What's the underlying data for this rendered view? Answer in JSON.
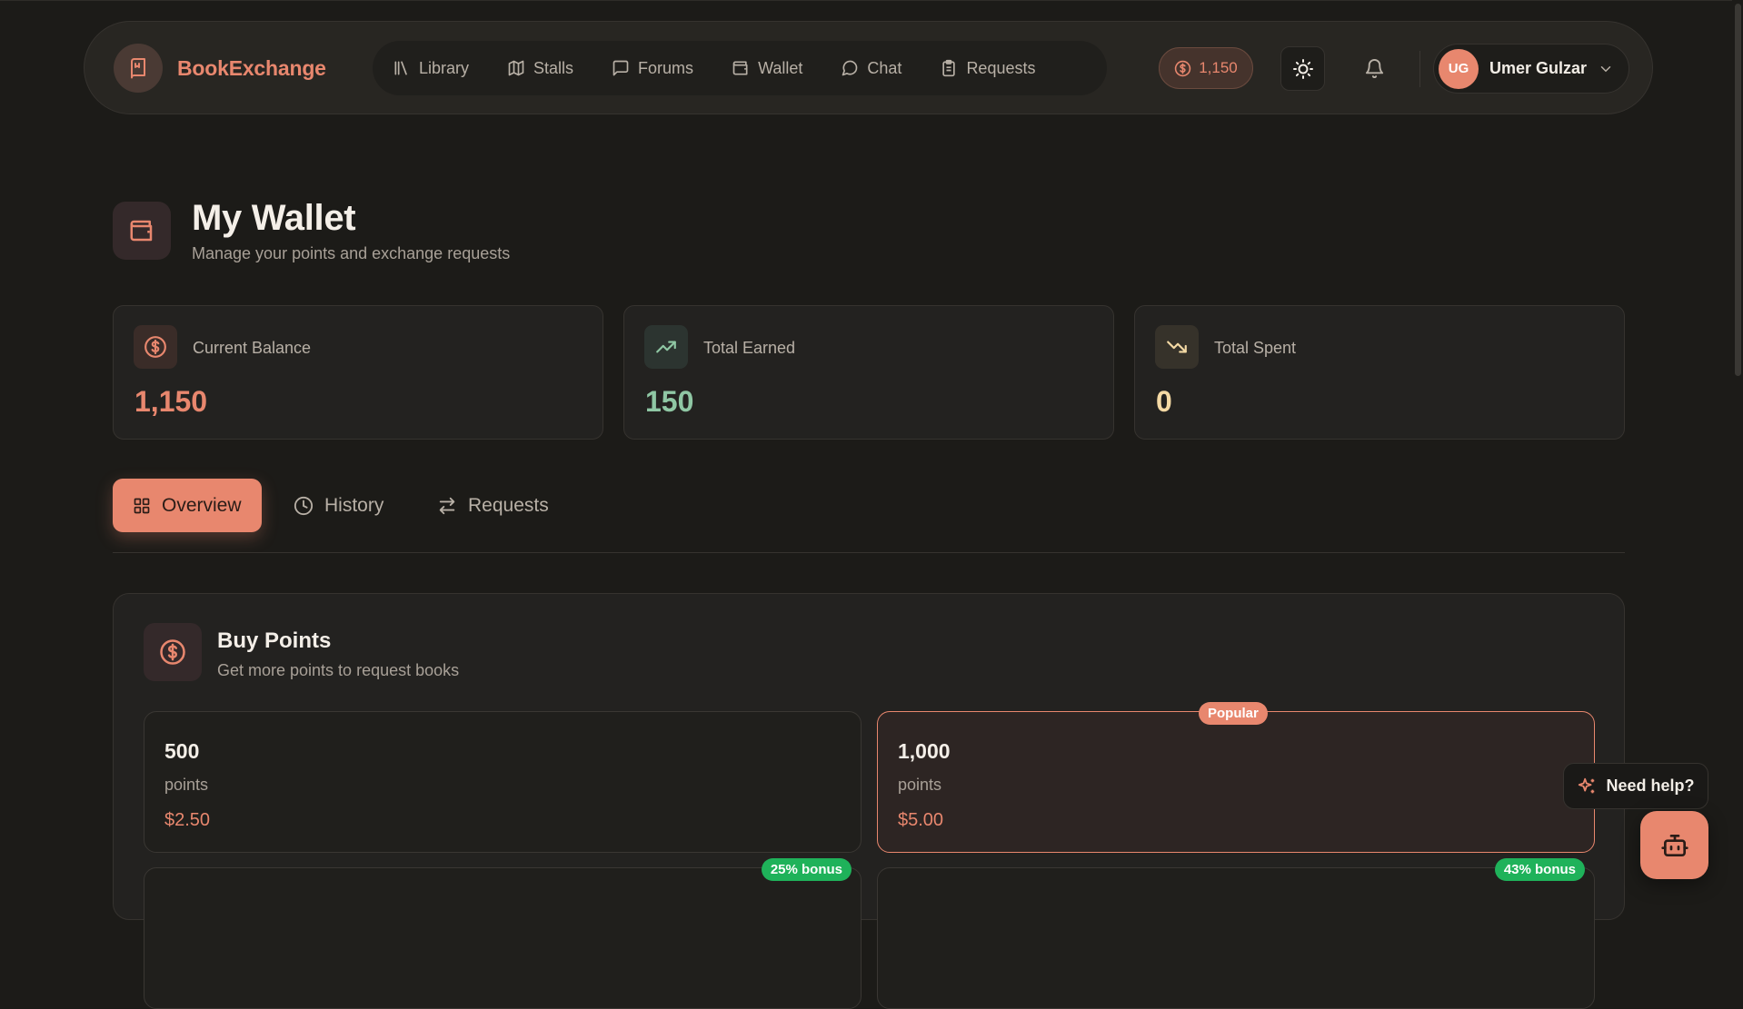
{
  "app": {
    "brand": "BookExchange"
  },
  "nav": {
    "items": [
      {
        "label": "Library",
        "icon": "library-icon"
      },
      {
        "label": "Stalls",
        "icon": "map-icon"
      },
      {
        "label": "Forums",
        "icon": "message-square-icon"
      },
      {
        "label": "Wallet",
        "icon": "wallet-icon"
      },
      {
        "label": "Chat",
        "icon": "message-circle-icon"
      },
      {
        "label": "Requests",
        "icon": "clipboard-icon"
      }
    ],
    "points": "1,150",
    "user": {
      "initials": "UG",
      "name": "Umer Gulzar"
    }
  },
  "header": {
    "title": "My Wallet",
    "subtitle": "Manage your points and exchange requests"
  },
  "stats": [
    {
      "label": "Current Balance",
      "value": "1,150",
      "color": "#e8876e",
      "icon": "dollar-circle-icon"
    },
    {
      "label": "Total Earned",
      "value": "150",
      "color": "#8fc7a4",
      "icon": "trending-up-icon"
    },
    {
      "label": "Total Spent",
      "value": "0",
      "color": "#f4d9a4",
      "icon": "trending-down-icon"
    }
  ],
  "tabs": [
    {
      "label": "Overview",
      "active": true
    },
    {
      "label": "History",
      "active": false
    },
    {
      "label": "Requests",
      "active": false
    }
  ],
  "buy_points": {
    "title": "Buy Points",
    "subtitle": "Get more points to request books",
    "packages": [
      {
        "amount": "500",
        "unit": "points",
        "price": "$2.50"
      },
      {
        "amount": "1,000",
        "unit": "points",
        "price": "$5.00",
        "badge": "Popular"
      },
      {
        "badge": "25% bonus"
      },
      {
        "badge": "43% bonus"
      }
    ]
  },
  "help": {
    "label": "Need help?"
  },
  "colors": {
    "accent": "#e8876e",
    "background": "#1c1b18",
    "success": "#1fb25a"
  }
}
